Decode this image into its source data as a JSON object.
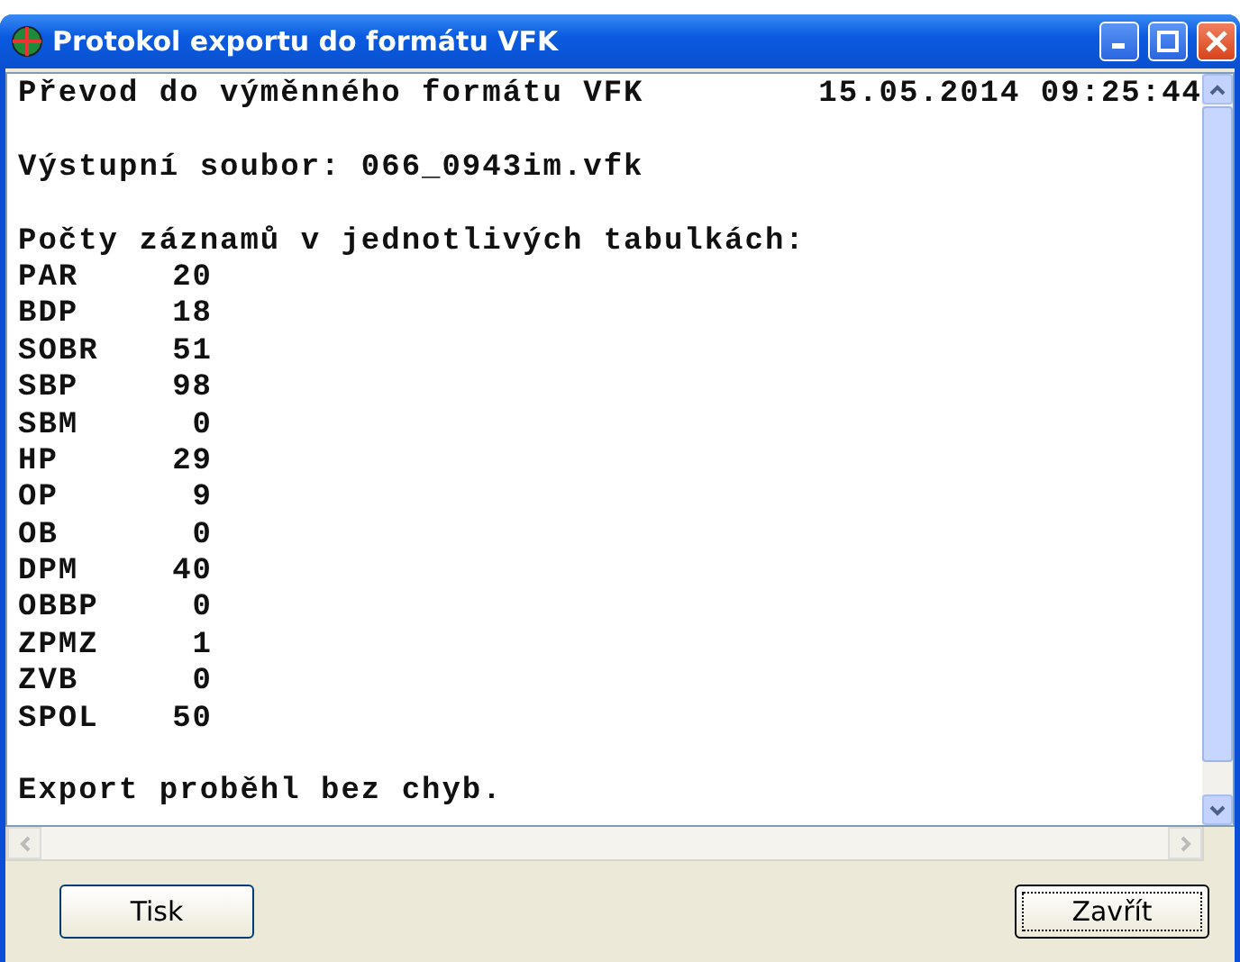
{
  "window": {
    "title": "Protokol exportu do formátu VFK"
  },
  "log": {
    "heading": "Převod do výměnného formátu VFK",
    "timestamp": "15.05.2014 09:25:44",
    "output_file": "Výstupní soubor: 066_0943im.vfk",
    "counts_heading": "Počty záznamů v jednotlivých tabulkách:",
    "rows": [
      {
        "table": "PAR",
        "count": "20"
      },
      {
        "table": "BDP",
        "count": "18"
      },
      {
        "table": "SOBR",
        "count": "51"
      },
      {
        "table": "SBP",
        "count": "98"
      },
      {
        "table": "SBM",
        "count": "0"
      },
      {
        "table": "HP",
        "count": "29"
      },
      {
        "table": "OP",
        "count": "9"
      },
      {
        "table": "OB",
        "count": "0"
      },
      {
        "table": "DPM",
        "count": "40"
      },
      {
        "table": "OBBP",
        "count": "0"
      },
      {
        "table": "ZPMZ",
        "count": "1"
      },
      {
        "table": "ZVB",
        "count": "0"
      },
      {
        "table": "SPOL",
        "count": "50"
      }
    ],
    "result": "Export proběhl bez chyb."
  },
  "buttons": [
    {
      "label": "Tisk",
      "focused": false
    },
    {
      "label": "Zavřít",
      "focused": true
    }
  ]
}
